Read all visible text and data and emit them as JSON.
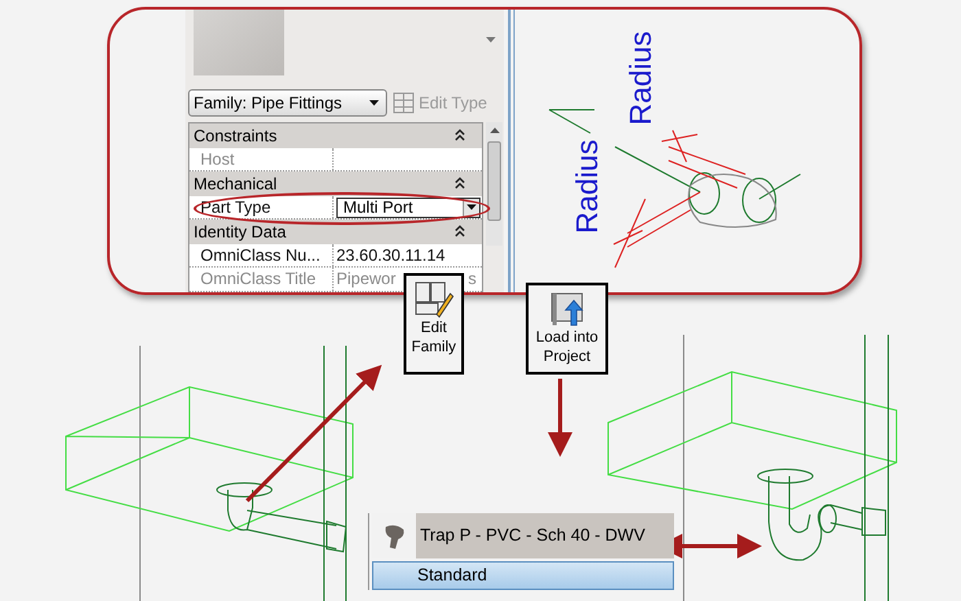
{
  "properties_panel": {
    "type_selector": "Family: Pipe Fittings",
    "edit_type_button": {
      "label": "Edit Type",
      "disabled": true
    },
    "groups": [
      {
        "name": "Constraints",
        "rows": [
          {
            "label": "Host",
            "disabled": true
          }
        ]
      },
      {
        "name": "Mechanical",
        "rows": [
          {
            "label": "Part Type",
            "value": "Multi Port",
            "kind": "dropdown",
            "highlighted": true,
            "disabled": false
          }
        ]
      },
      {
        "name": "Identity Data",
        "rows": [
          {
            "label": "OmniClass Nu...",
            "value": "23.60.30.11.14",
            "kind": "text",
            "highlighted": false,
            "disabled": false
          },
          {
            "label": "OmniClass Title",
            "value": "Pipewor",
            "value_tail": "s",
            "kind": "text",
            "highlighted": false,
            "disabled": true
          }
        ]
      }
    ]
  },
  "drawing_labels": [
    "Radius",
    "Radius"
  ],
  "ribbon_buttons": [
    {
      "label": "Edit Family",
      "kind": "edit"
    },
    {
      "label": "Load into Project",
      "kind": "load"
    }
  ],
  "type_list": {
    "items": [
      {
        "label": "Trap P - PVC - Sch 40 - DWV",
        "kind": "family",
        "selected": false
      },
      {
        "label": "Standard",
        "kind": "type",
        "selected": true
      }
    ]
  }
}
